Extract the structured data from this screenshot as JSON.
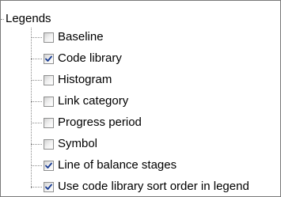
{
  "tree": {
    "root_label": "Legends",
    "items": [
      {
        "label": "Baseline",
        "checked": false
      },
      {
        "label": "Code library",
        "checked": true
      },
      {
        "label": "Histogram",
        "checked": false
      },
      {
        "label": "Link category",
        "checked": false
      },
      {
        "label": "Progress period",
        "checked": false
      },
      {
        "label": "Symbol",
        "checked": false
      },
      {
        "label": "Line of balance stages",
        "checked": true
      },
      {
        "label": "Use code library sort order in legend",
        "checked": true
      }
    ]
  },
  "colors": {
    "check_mark": "#1c3f95",
    "checkbox_border": "#8e8f8f",
    "tree_line": "#8a8a8a"
  }
}
